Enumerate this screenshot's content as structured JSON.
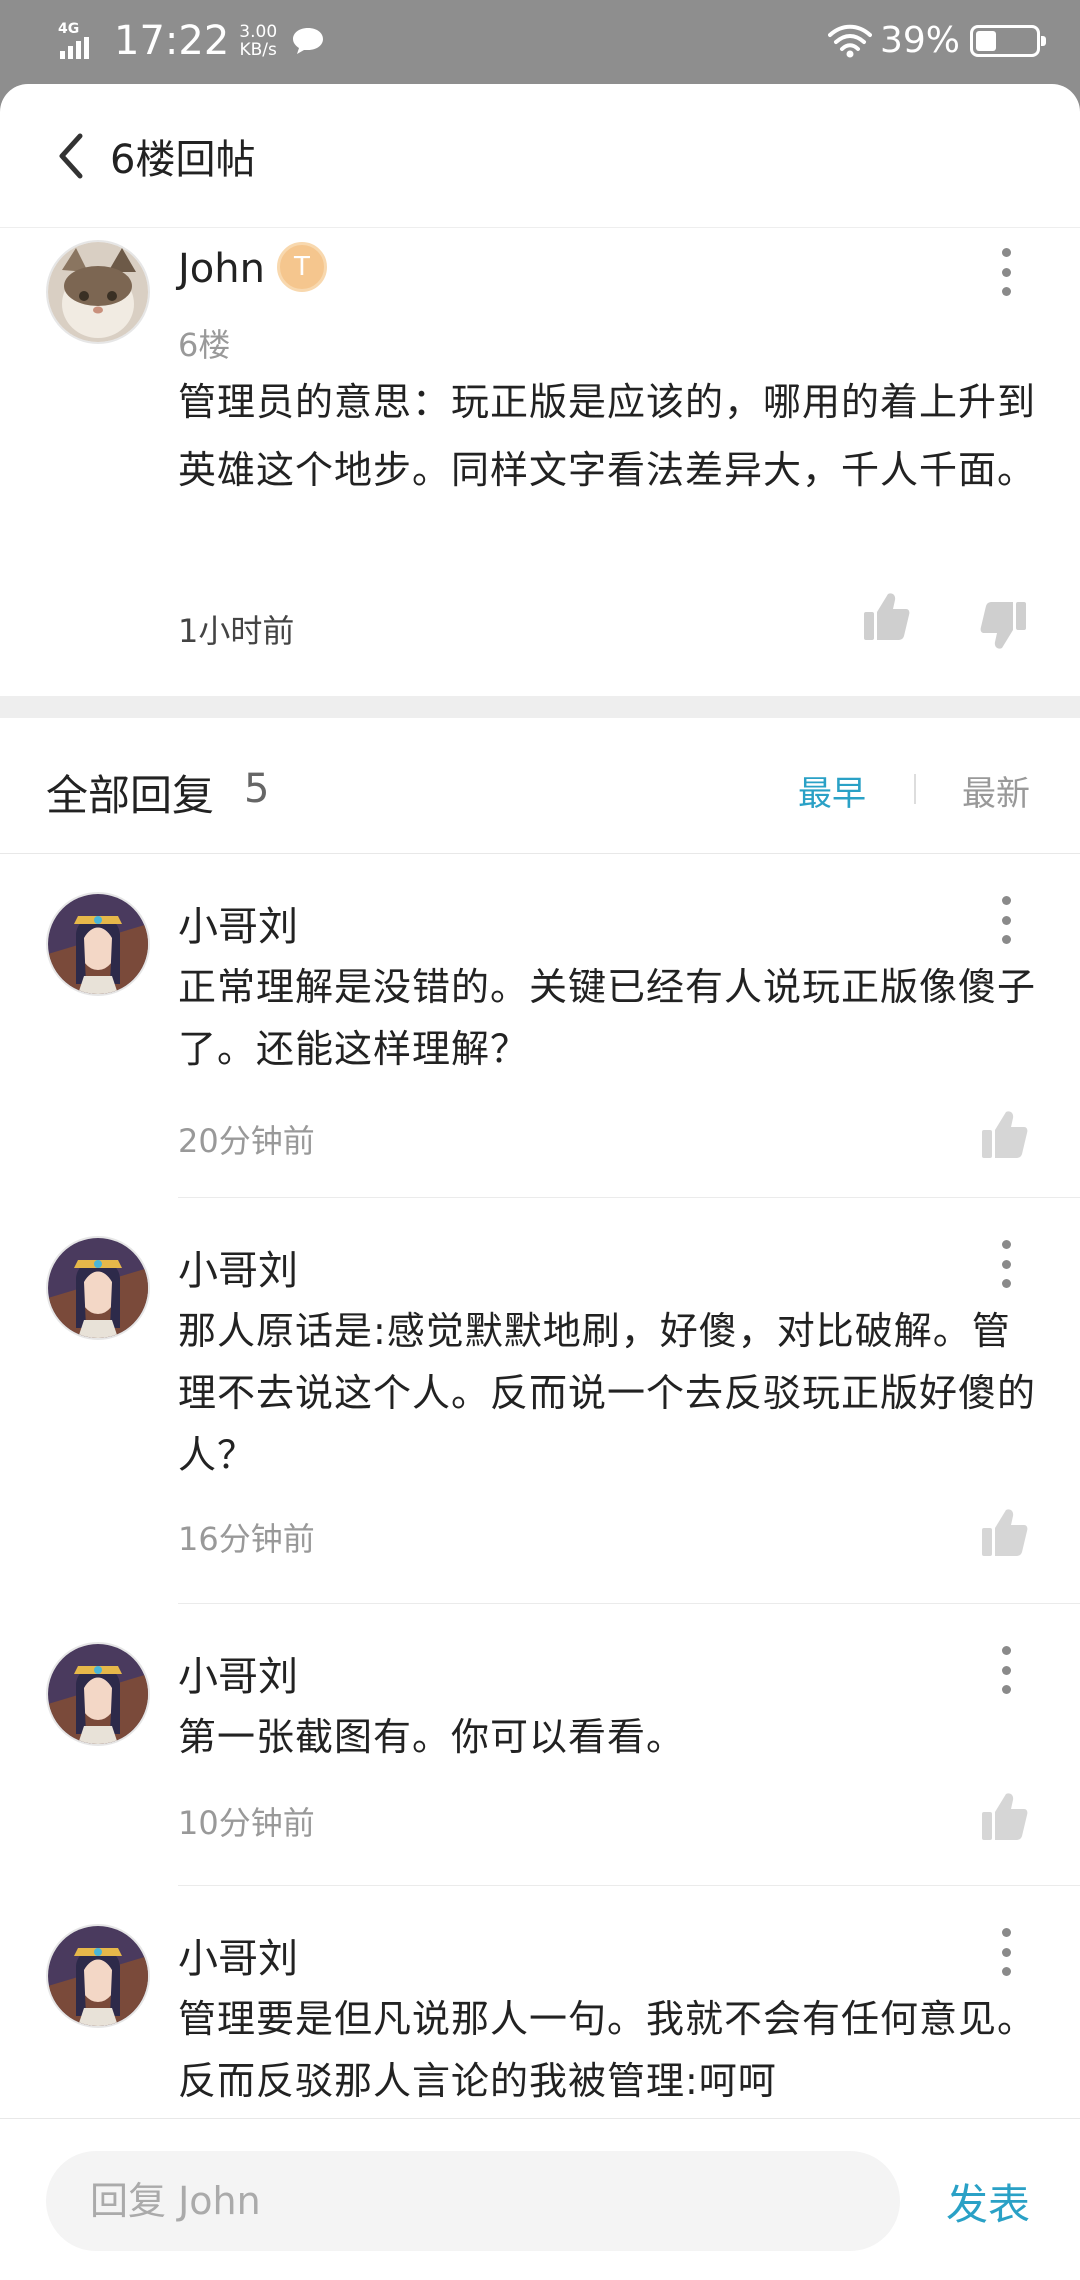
{
  "status_bar": {
    "network": "4G",
    "time": "17:22",
    "speed_value": "3.00",
    "speed_unit": "KB/s",
    "battery": "39%"
  },
  "header": {
    "title": "6楼回帖"
  },
  "original_post": {
    "username": "John",
    "badge_text": "T",
    "floor": "6楼",
    "text": "管理员的意思：玩正版是应该的，哪用的着上升到英雄这个地步。同样文字看法差异大，千人千面。",
    "time": "1小时前"
  },
  "replies_header": {
    "title": "全部回复",
    "count": "5",
    "sort_earliest": "最早",
    "sort_newest": "最新"
  },
  "replies": [
    {
      "username": "小哥刘",
      "text": "正常理解是没错的。关键已经有人说玩正版像傻子了。还能这样理解？",
      "time": "20分钟前"
    },
    {
      "username": "小哥刘",
      "text": "那人原话是:感觉默默地刷，好傻，对比破解。管理不去说这个人。反而说一个去反驳玩正版好傻的人？",
      "time": "16分钟前"
    },
    {
      "username": "小哥刘",
      "text": "第一张截图有。你可以看看。",
      "time": "10分钟前"
    },
    {
      "username": "小哥刘",
      "text": "管理要是但凡说那人一句。我就不会有任何意见。反而反驳那人言论的我被管理:呵呵",
      "time": ""
    }
  ],
  "bottom_bar": {
    "input_placeholder": "回复 John",
    "send_label": "发表"
  },
  "colors": {
    "accent": "#2aa1c6",
    "status_bar_bg": "#8e8e8e",
    "badge": "#f5c68e"
  }
}
